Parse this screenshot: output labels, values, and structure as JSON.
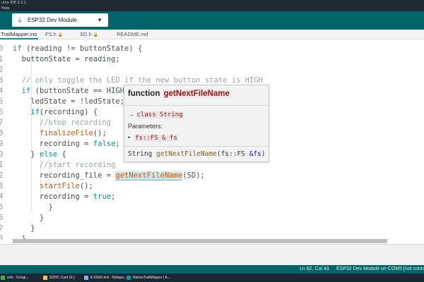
{
  "window": {
    "title": "uino IDE 2.2.1"
  },
  "menubar": {
    "help": "Help"
  },
  "toolbar": {
    "board": "ESP32 Dev Module",
    "usb_icon": "usb-icon",
    "chevron_icon": "chevron-down-icon"
  },
  "tabs": [
    {
      "label": "TrailMapper.ino",
      "locked": false
    },
    {
      "label": "FS.h",
      "locked": true
    },
    {
      "label": "SD.h",
      "locked": true
    },
    {
      "label": "README.md",
      "locked": false
    }
  ],
  "editor": {
    "lines": [
      {
        "ln": "0",
        "text": "    if (reading != buttonState) {"
      },
      {
        "ln": "1",
        "text": "      buttonState = reading;"
      },
      {
        "ln": "2",
        "text": ""
      },
      {
        "ln": "3",
        "text": "      // only toggle the LED if the new button state is HIGH"
      },
      {
        "ln": "4",
        "text": "      if (buttonState == HIGH) {"
      },
      {
        "ln": "5",
        "text": "        ledState = !ledState;"
      },
      {
        "ln": "6",
        "text": "        if(recording) {"
      },
      {
        "ln": "7",
        "text": "          //stop recording"
      },
      {
        "ln": "8",
        "text": "          finalizeFile();"
      },
      {
        "ln": "9",
        "text": "          recording = false;"
      },
      {
        "ln": "0",
        "text": "        } else {"
      },
      {
        "ln": "1",
        "text": "          //start recording"
      },
      {
        "ln": "2",
        "text": "          recording_file = getNextFileName(SD);"
      },
      {
        "ln": "3",
        "text": "          startFile();"
      },
      {
        "ln": "4",
        "text": "          recording = true;"
      },
      {
        "ln": "5",
        "text": "        }"
      },
      {
        "ln": "6",
        "text": "      }"
      },
      {
        "ln": "7",
        "text": "    }"
      },
      {
        "ln": "8",
        "text": "  }"
      },
      {
        "ln": "9",
        "text": ""
      }
    ]
  },
  "hover": {
    "keyword": "function",
    "name": "getNextFileName",
    "arrow": "→",
    "return_type": "class String",
    "params_label": "Parameters:",
    "bullet": "•",
    "param": "fs::FS & fs",
    "sig_return": "String ",
    "sig_fn": "getNextFileName",
    "sig_open": "(fs::FS ",
    "sig_amp": "&fs",
    "sig_close": ")"
  },
  "status": {
    "position": "Ln 82, Col 43",
    "board": "ESP32 Dev Module on COM5 [not conne"
  },
  "taskbar": [
    {
      "label": "arth - Googl...",
      "color": "#4caf50"
    },
    {
      "label": "SDHC Card (E:)",
      "color": "#f5c542"
    },
    {
      "label": "E:\\0002.kml - Notepa...",
      "color": "#7ab8ff"
    },
    {
      "label": "NatureTrailMapper | A...",
      "color": "#00979d"
    }
  ]
}
